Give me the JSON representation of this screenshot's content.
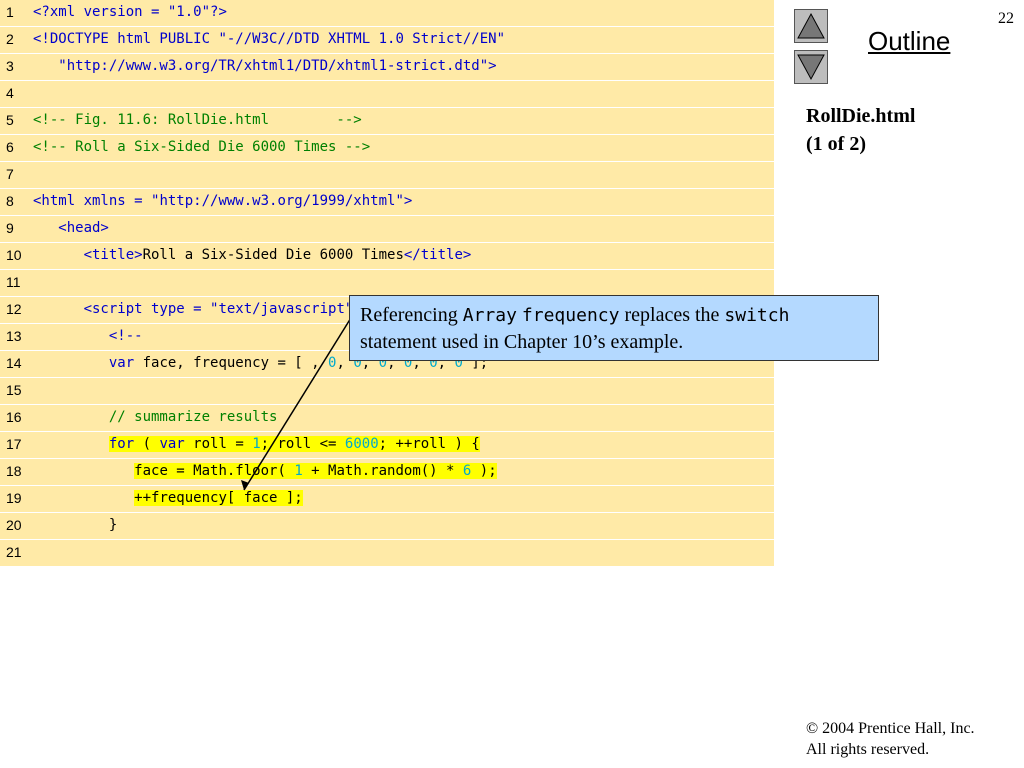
{
  "slide": {
    "page_number": "22",
    "outline_title": "Outline",
    "file_label": "RollDie.html",
    "file_part": "(1 of 2)",
    "copyright_line1": "2004 Prentice Hall, Inc.",
    "copyright_line2": "All rights reserved.",
    "copyright_symbol": "©"
  },
  "callout": {
    "t1": "Referencing ",
    "m1": "Array",
    "t2": " ",
    "m2": "frequency",
    "t3": " replaces the ",
    "m3": "switch",
    "t4": " statement used in Chapter 10’s example."
  },
  "code": [
    {
      "n": "1",
      "segs": [
        {
          "t": "<?xml version = ",
          "c": "kw"
        },
        {
          "t": "\"1.0\"",
          "c": "str"
        },
        {
          "t": "?>",
          "c": "kw"
        }
      ]
    },
    {
      "n": "2",
      "segs": [
        {
          "t": "<!DOCTYPE html PUBLIC ",
          "c": "kw"
        },
        {
          "t": "\"-//W3C//DTD XHTML 1.0 Strict//EN\"",
          "c": "str"
        }
      ]
    },
    {
      "n": "3",
      "segs": [
        {
          "t": "   \"http://www.w3.org/TR/xhtml1/DTD/xhtml1-strict.dtd\"",
          "c": "str"
        },
        {
          "t": ">",
          "c": "kw"
        }
      ]
    },
    {
      "n": "4",
      "segs": []
    },
    {
      "n": "5",
      "segs": [
        {
          "t": "<!-- Fig. 11.6: RollDie.html        -->",
          "c": "cm"
        }
      ]
    },
    {
      "n": "6",
      "segs": [
        {
          "t": "<!-- Roll a Six-Sided Die 6000 Times -->",
          "c": "cm"
        }
      ]
    },
    {
      "n": "7",
      "segs": []
    },
    {
      "n": "8",
      "segs": [
        {
          "t": "<html xmlns = ",
          "c": "kw"
        },
        {
          "t": "\"http://www.w3.org/1999/xhtml\"",
          "c": "str"
        },
        {
          "t": ">",
          "c": "kw"
        }
      ]
    },
    {
      "n": "9",
      "segs": [
        {
          "t": "   <head>",
          "c": "kw"
        }
      ]
    },
    {
      "n": "10",
      "segs": [
        {
          "t": "      <title>",
          "c": "kw"
        },
        {
          "t": "Roll a Six-Sided Die 6000 Times",
          "c": ""
        },
        {
          "t": "</title>",
          "c": "kw"
        }
      ]
    },
    {
      "n": "11",
      "segs": []
    },
    {
      "n": "12",
      "segs": [
        {
          "t": "      <script type = ",
          "c": "kw"
        },
        {
          "t": "\"text/javascript\"",
          "c": "str"
        },
        {
          "t": ">",
          "c": "kw"
        }
      ]
    },
    {
      "n": "13",
      "segs": [
        {
          "t": "         <!--",
          "c": "kw"
        }
      ]
    },
    {
      "n": "14",
      "segs": [
        {
          "t": "         ",
          "c": ""
        },
        {
          "t": "var",
          "c": "kw"
        },
        {
          "t": " face, frequency = [ ",
          "c": ""
        },
        {
          "t": ",",
          "c": ""
        },
        {
          "t": " 0",
          "c": "num"
        },
        {
          "t": ",",
          "c": ""
        },
        {
          "t": " 0",
          "c": "num"
        },
        {
          "t": ",",
          "c": ""
        },
        {
          "t": " 0",
          "c": "num"
        },
        {
          "t": ",",
          "c": ""
        },
        {
          "t": " 0",
          "c": "num"
        },
        {
          "t": ",",
          "c": ""
        },
        {
          "t": " 0",
          "c": "num"
        },
        {
          "t": ",",
          "c": ""
        },
        {
          "t": " 0",
          "c": "num"
        },
        {
          "t": " ];",
          "c": ""
        }
      ]
    },
    {
      "n": "15",
      "segs": []
    },
    {
      "n": "16",
      "segs": [
        {
          "t": "         // summarize results",
          "c": "cm"
        }
      ]
    },
    {
      "n": "17",
      "segs": [
        {
          "t": "         ",
          "c": ""
        },
        {
          "t": "for",
          "c": "kw hl"
        },
        {
          "t": " ( ",
          "c": "hl"
        },
        {
          "t": "var",
          "c": "kw hl"
        },
        {
          "t": " roll = ",
          "c": "hl"
        },
        {
          "t": "1",
          "c": "num hl"
        },
        {
          "t": "; roll <= ",
          "c": "hl"
        },
        {
          "t": "6000",
          "c": "num hl"
        },
        {
          "t": "; ++roll ) {",
          "c": "hl"
        }
      ]
    },
    {
      "n": "18",
      "segs": [
        {
          "t": "            ",
          "c": ""
        },
        {
          "t": "face = Math.floor( ",
          "c": "hl"
        },
        {
          "t": "1",
          "c": "num hl"
        },
        {
          "t": " + Math.random() * ",
          "c": "hl"
        },
        {
          "t": "6",
          "c": "num hl"
        },
        {
          "t": " );",
          "c": "hl"
        }
      ]
    },
    {
      "n": "19",
      "segs": [
        {
          "t": "            ",
          "c": ""
        },
        {
          "t": "++frequency[ face ];",
          "c": "hl"
        }
      ]
    },
    {
      "n": "20",
      "segs": [
        {
          "t": "         }",
          "c": ""
        }
      ]
    },
    {
      "n": "21",
      "segs": []
    }
  ]
}
